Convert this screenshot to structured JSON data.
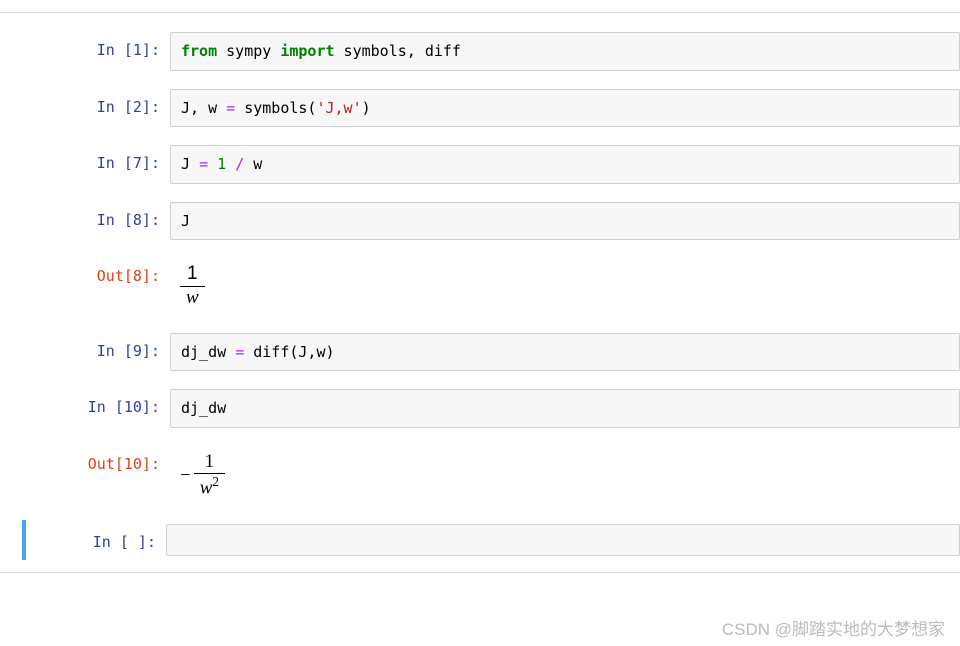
{
  "cells": {
    "c1": {
      "prompt_in": "In  [1]:"
    },
    "code1": {
      "from": "from",
      "module": " sympy ",
      "import": "import",
      "items": " symbols, diff"
    },
    "c2": {
      "prompt_in": "In  [2]:"
    },
    "code2": {
      "lhs": "J, w ",
      "op": "=",
      "func": " symbols(",
      "str": "'J,w'",
      "close": ")"
    },
    "c3": {
      "prompt_in": "In  [7]:"
    },
    "code3": {
      "lhs": "J ",
      "op": "=",
      "sp1": " ",
      "num": "1",
      "sp2": " ",
      "div": "/",
      "rhs": " w"
    },
    "c4": {
      "prompt_in": "In  [8]:"
    },
    "code4": {
      "text": "J"
    },
    "o4": {
      "prompt_out": "Out[8]:",
      "num": "1",
      "den": "w"
    },
    "c5": {
      "prompt_in": "In  [9]:"
    },
    "code5": {
      "lhs": "dj_dw ",
      "op": "=",
      "rhs": " diff(J,w)"
    },
    "c6": {
      "prompt_in": "In [10]:"
    },
    "code6": {
      "text": "dj_dw"
    },
    "o6": {
      "prompt_out": "Out[10]:",
      "minus": "−",
      "num": "1",
      "den_base": "w",
      "den_exp": "2"
    },
    "c7": {
      "prompt_in": "In  [ ]:"
    }
  },
  "watermark": "CSDN @脚踏实地的大梦想家"
}
